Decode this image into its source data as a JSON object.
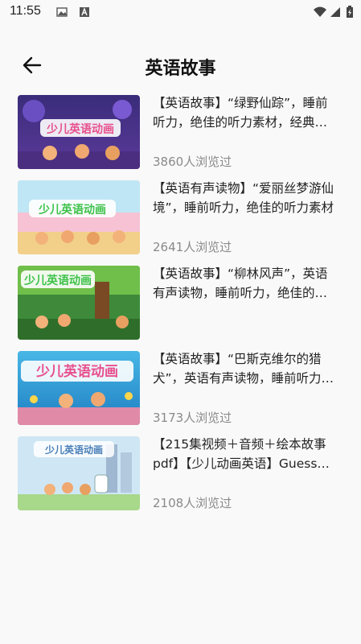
{
  "status": {
    "time": "11:55"
  },
  "header": {
    "title": "英语故事"
  },
  "items": [
    {
      "title": "【英语故事】“绿野仙踪”，睡前听力，绝佳的听力素材，经典英语故事",
      "views": "3860人浏览过",
      "thumb_text": "少儿英语动画"
    },
    {
      "title": "【英语有声读物】“爱丽丝梦游仙境”，睡前听力，绝佳的听力素材",
      "views": "2641人浏览过",
      "thumb_text": "少儿英语动画"
    },
    {
      "title": "【英语故事】“柳林风声”，英语有声读物，睡前听力，绝佳的听力素材",
      "views": "",
      "thumb_text": "少儿英语动画"
    },
    {
      "title": "【英语故事】“巴斯克维尔的猎犬”，英语有声读物，睡前听力，绝佳的听力素材",
      "views": "3173人浏览过",
      "thumb_text": "少儿英语动画"
    },
    {
      "title": "【215集视频＋音频＋绘本故事pdf】【少儿动画英语】Guess How Much I Love You",
      "views": "2108人浏览过",
      "thumb_text": "少儿英语动画"
    }
  ],
  "colors": {
    "accent_pink": "#e8508e",
    "green_text": "#3ec24a",
    "blue_bg": "#3aa0d8"
  }
}
